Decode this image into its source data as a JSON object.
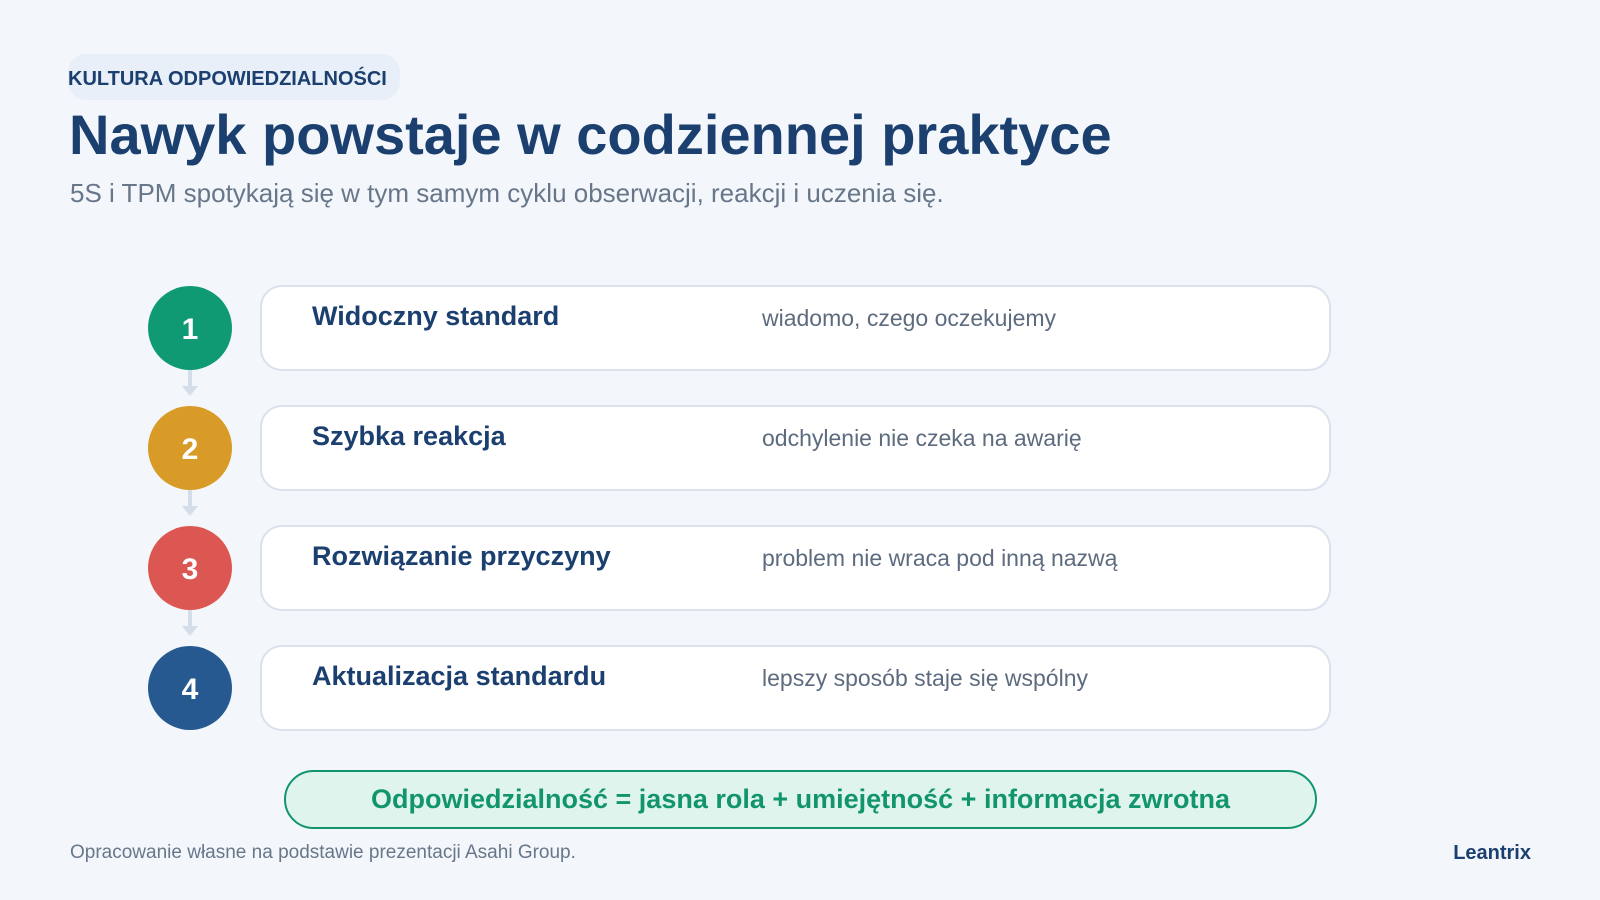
{
  "header": {
    "eyebrow": "KULTURA ODPOWIEDZIALNOŚCI",
    "title": "Nawyk powstaje w codziennej praktyce",
    "subtitle": "5S i TPM spotykają się w tym samym cyklu obserwacji, reakcji i uczenia się."
  },
  "steps": [
    {
      "number": "1",
      "title": "Widoczny standard",
      "description": "wiadomo, czego oczekujemy",
      "color": "#0f9a73"
    },
    {
      "number": "2",
      "title": "Szybka reakcja",
      "description": "odchylenie nie czeka na awarię",
      "color": "#d99b27"
    },
    {
      "number": "3",
      "title": "Rozwiązanie przyczyny",
      "description": "problem nie wraca pod inną nazwą",
      "color": "#dc5752"
    },
    {
      "number": "4",
      "title": "Aktualizacja standardu",
      "description": "lepszy sposób staje się wspólny",
      "color": "#265990"
    }
  ],
  "summary": {
    "text": "Odpowiedzialność = jasna rola + umiejętność + informacja zwrotna",
    "color": "#12956d"
  },
  "footer": {
    "source": "Opracowanie własne na podstawie prezentacji Asahi Group.",
    "brand": "Leantrix"
  }
}
